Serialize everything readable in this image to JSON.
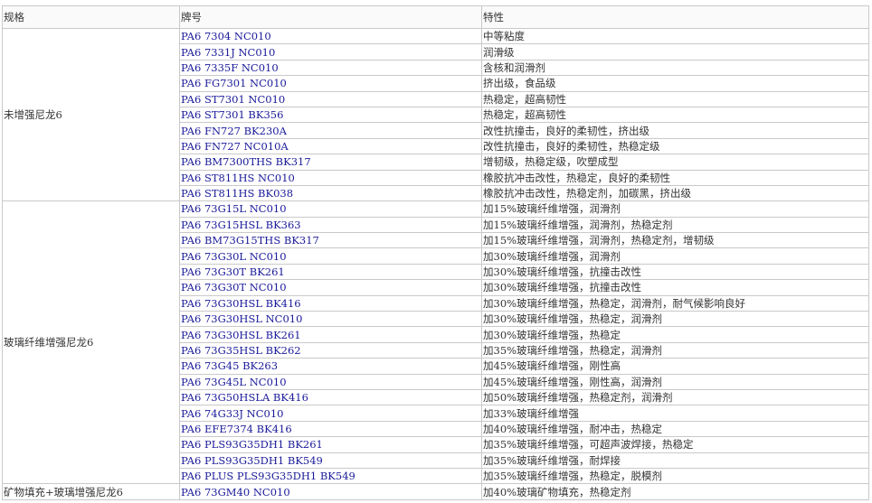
{
  "clipped_heading": "__ __ __ __ __ __",
  "headers": [
    "规格",
    "牌号",
    "特性"
  ],
  "groups": [
    {
      "name": "未增强尼龙6",
      "rows": [
        [
          "PA6 7304 NC010",
          "中等粘度"
        ],
        [
          "PA6 7331J NC010",
          "润滑级"
        ],
        [
          "PA6 7335F NC010",
          "含核和润滑剂"
        ],
        [
          "PA6 FG7301 NC010",
          "挤出级，食品级"
        ],
        [
          "PA6 ST7301 NC010",
          "热稳定，超高韧性"
        ],
        [
          "PA6 ST7301 BK356",
          "热稳定，超高韧性"
        ],
        [
          "PA6 FN727 BK230A",
          "改性抗撞击，良好的柔韧性，挤出级"
        ],
        [
          "PA6 FN727 NC010A",
          "改性抗撞击，良好的柔韧性，热稳定级"
        ],
        [
          "PA6 BM7300THS BK317",
          "增韧级，热稳定级，吹塑成型"
        ],
        [
          "PA6 ST811HS NC010",
          "橡胶抗冲击改性，热稳定，良好的柔韧性"
        ],
        [
          "PA6 ST811HS BK038",
          "橡胶抗冲击改性，热稳定剂，加碳黑，挤出级"
        ]
      ]
    },
    {
      "name": "玻璃纤维增强尼龙6",
      "rows": [
        [
          "PA6 73G15L NC010",
          "加15%玻璃纤维增强，润滑剂"
        ],
        [
          "PA6 73G15HSL BK363",
          "加15%玻璃纤维增强，润滑剂，热稳定剂"
        ],
        [
          "PA6 BM73G15THS BK317",
          "加15%玻璃纤维增强，润滑剂，热稳定剂，增韧级"
        ],
        [
          "PA6 73G30L NC010",
          "加30%玻璃纤维增强，润滑剂"
        ],
        [
          "PA6 73G30T BK261",
          "加30%玻璃纤维增强，抗撞击改性"
        ],
        [
          "PA6 73G30T NC010",
          "加30%玻璃纤维增强，抗撞击改性"
        ],
        [
          "PA6 73G30HSL BK416",
          "加30%玻璃纤维增强，热稳定，润滑剂，耐气候影响良好"
        ],
        [
          "PA6 73G30HSL NC010",
          "加30%玻璃纤维增强，热稳定，润滑剂"
        ],
        [
          "PA6 73G30HSL BK261",
          "加30%玻璃纤维增强，热稳定"
        ],
        [
          "PA6 73G35HSL BK262",
          "加35%玻璃纤维增强，热稳定，润滑剂"
        ],
        [
          "PA6 73G45 BK263",
          "加45%玻璃纤维增强，刚性高"
        ],
        [
          "PA6 73G45L NC010",
          "加45%玻璃纤维增强，刚性高，润滑剂"
        ],
        [
          "PA6 73G50HSLA BK416",
          "加50%玻璃纤维增强，热稳定剂，润滑剂"
        ],
        [
          "PA6 74G33J NC010",
          "加33%玻璃纤维增强"
        ],
        [
          "PA6 EFE7374 BK416",
          "加40%玻璃纤维增强，耐冲击，热稳定"
        ],
        [
          "PA6 PLS93G35DH1 BK261",
          "加35%玻璃纤维增强，可超声波焊接，热稳定"
        ],
        [
          "PA6 PLS93G35DH1 BK549",
          "加35%玻璃纤维增强，耐焊接"
        ],
        [
          "PA6 PLUS PLS93G35DH1 BK549",
          "加35%玻璃纤维增强，热稳定，脱模剂"
        ]
      ]
    },
    {
      "name": "矿物填充+玻璃增强尼龙6",
      "rows": [
        [
          "PA6 73GM40 NC010",
          "加40%玻璃矿物填充，热稳定剂"
        ]
      ]
    }
  ]
}
